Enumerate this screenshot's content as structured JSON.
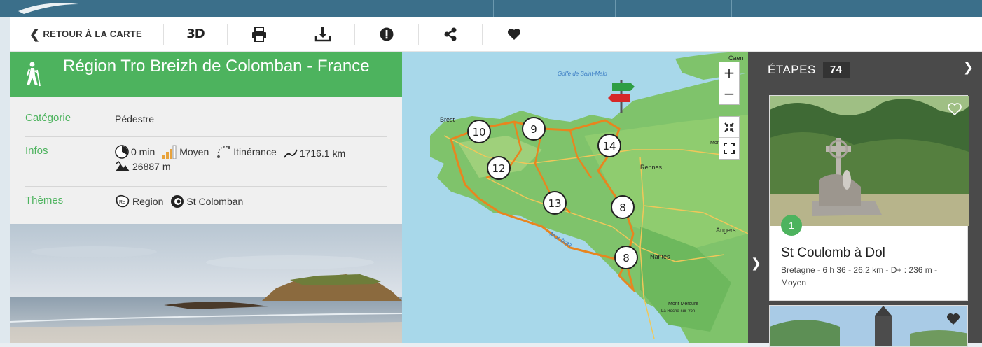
{
  "toolbar": {
    "back_label": "RETOUR À LA CARTE",
    "buttons": [
      {
        "name": "3d-icon",
        "label": "3D"
      },
      {
        "name": "print-icon",
        "label": ""
      },
      {
        "name": "download-icon",
        "label": ""
      },
      {
        "name": "report-icon",
        "label": ""
      },
      {
        "name": "share-icon",
        "label": ""
      },
      {
        "name": "heart-icon",
        "label": ""
      }
    ]
  },
  "route": {
    "title": "Région Tro Breizh de Colomban - France",
    "categorie_label": "Catégorie",
    "categorie_value": "Pédestre",
    "infos_label": "Infos",
    "duration": "0 min",
    "difficulty": "Moyen",
    "type": "Itinérance",
    "distance": "1716.1 km",
    "elevation": "26887 m",
    "themes_label": "Thèmes",
    "theme_1": "Region",
    "theme_2": "St Colomban"
  },
  "map": {
    "clusters": [
      "10",
      "9",
      "14",
      "12",
      "13",
      "8",
      "8"
    ],
    "labels": {
      "golfe": "Golfe de Saint-Malo",
      "rennes": "Rennes",
      "angers": "Angers",
      "nantes": "Nantes",
      "mont_mercure": "Mont Mercure",
      "roche": "La Roche-sur-Yon",
      "mor_braz": "Mor braz",
      "brest": "Brest",
      "caen": "Caen",
      "mont_des": "Mont des A"
    },
    "zoom_in": "+",
    "zoom_out": "−"
  },
  "etapes": {
    "title": "ÉTAPES",
    "count": "74",
    "card": {
      "number": "1",
      "title": "St Coulomb à Dol",
      "details": "Bretagne - 6 h 36 - 26.2 km - D+ : 236 m - Moyen"
    }
  },
  "colors": {
    "green": "#4db35e",
    "dark_panel": "#4a4a4a",
    "topnav": "#3b6f8a"
  }
}
